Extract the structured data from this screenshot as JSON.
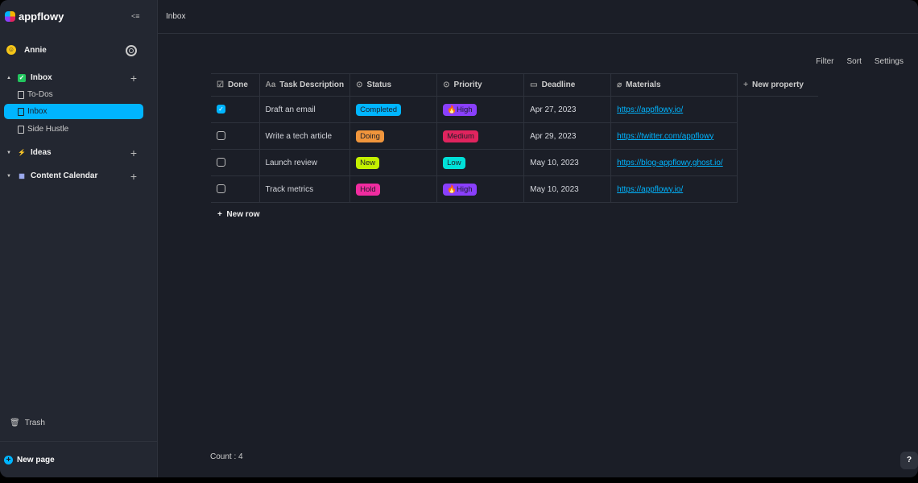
{
  "app": {
    "name": "appflowy"
  },
  "user": {
    "name": "Annie"
  },
  "sidebar": {
    "sections": [
      {
        "label": "Inbox",
        "icon": "✓",
        "color": "#22c55e"
      },
      {
        "label": "Ideas",
        "icon": "⚡",
        "color": "#f97316"
      },
      {
        "label": "Content Calendar",
        "icon": "▦",
        "color": "#a5b4fc"
      }
    ],
    "pages": [
      "To-Dos",
      "Inbox",
      "Side Hustle"
    ],
    "trash": "Trash",
    "new_page": "New page"
  },
  "header": {
    "title": "Inbox"
  },
  "toolbar": {
    "filter": "Filter",
    "sort": "Sort",
    "settings": "Settings"
  },
  "table": {
    "columns": [
      "Done",
      "Task Description",
      "Status",
      "Priority",
      "Deadline",
      "Materials",
      "New property"
    ],
    "rows": [
      {
        "done": true,
        "task": "Draft an email",
        "status": "Completed",
        "status_color": "#00b5ff",
        "priority": "High",
        "priority_color": "#8a3ffc",
        "priority_fire": true,
        "deadline": "Apr 27, 2023",
        "link": "https://appflowy.io/"
      },
      {
        "done": false,
        "task": "Write a tech article",
        "status": "Doing",
        "status_color": "#f0953c",
        "priority": "Medium",
        "priority_color": "#e0245e",
        "priority_fire": false,
        "deadline": "Apr 29, 2023",
        "link": "https://twitter.com/appflowy"
      },
      {
        "done": false,
        "task": "Launch review",
        "status": "New",
        "status_color": "#c4f000",
        "priority": "Low",
        "priority_color": "#00e0d8",
        "priority_fire": false,
        "deadline": "May 10, 2023",
        "link": "https://blog-appflowy.ghost.io/"
      },
      {
        "done": false,
        "task": "Track metrics",
        "status": "Hold",
        "status_color": "#f02ca0",
        "priority": "High",
        "priority_color": "#8a3ffc",
        "priority_fire": true,
        "deadline": "May 10, 2023",
        "link": "https://appflowy.io/"
      }
    ],
    "new_row": "New row",
    "count": "Count : 4"
  },
  "help": "?"
}
